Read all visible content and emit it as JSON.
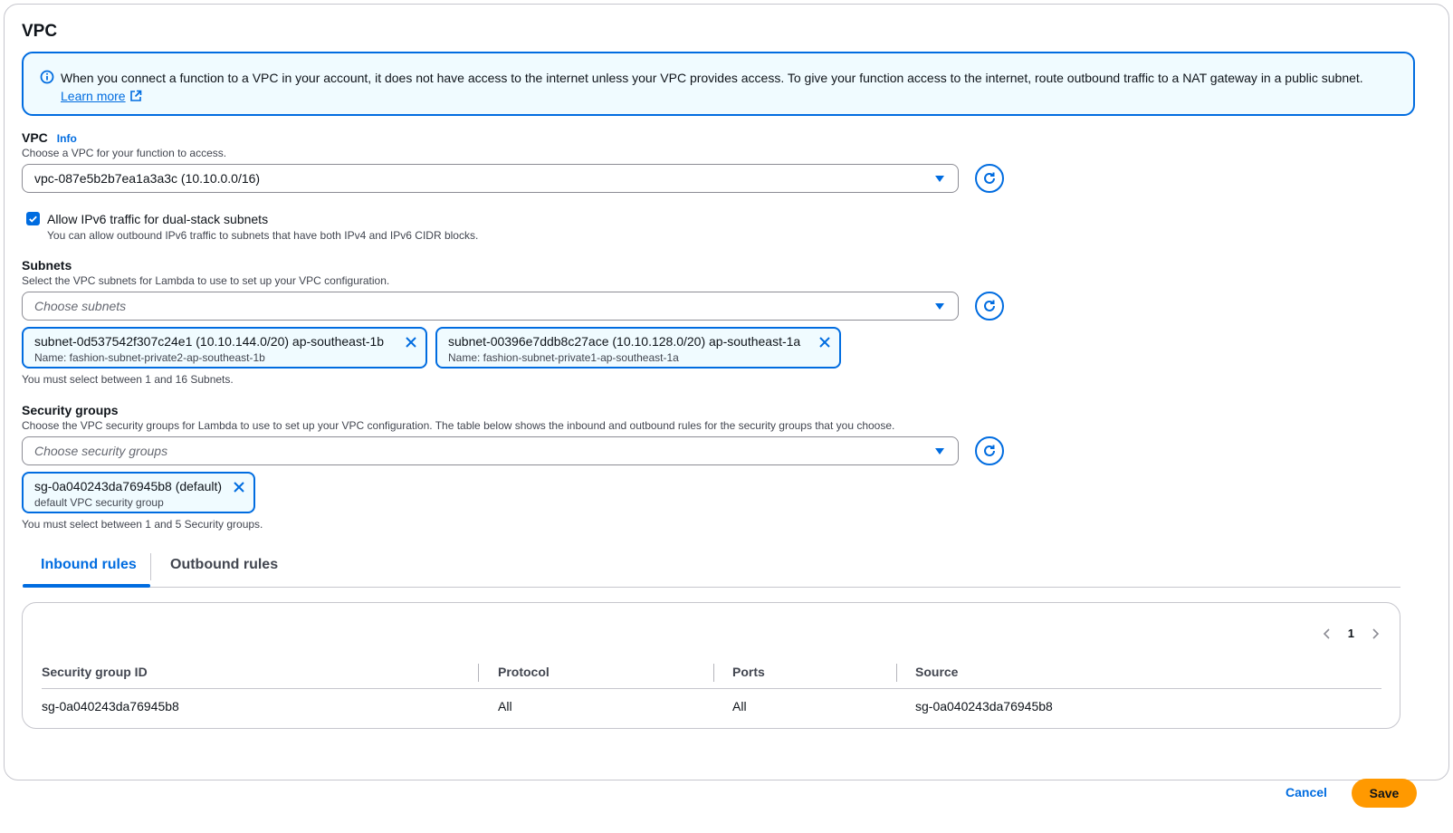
{
  "section": {
    "title": "VPC"
  },
  "alert": {
    "text": "When you connect a function to a VPC in your account, it does not have access to the internet unless your VPC provides access. To give your function access to the internet, route outbound traffic to a NAT gateway in a public subnet.",
    "link": "Learn more"
  },
  "vpc": {
    "label": "VPC",
    "info": "Info",
    "description": "Choose a VPC for your function to access.",
    "value": "vpc-087e5b2b7ea1a3a3c (10.10.0.0/16)"
  },
  "ipv6": {
    "label": "Allow IPv6 traffic for dual-stack subnets",
    "description": "You can allow outbound IPv6 traffic to subnets that have both IPv4 and IPv6 CIDR blocks.",
    "checked": true
  },
  "subnets": {
    "label": "Subnets",
    "description": "Select the VPC subnets for Lambda to use to set up your VPC configuration.",
    "placeholder": "Choose subnets",
    "tokens": [
      {
        "main": "subnet-0d537542f307c24e1 (10.10.144.0/20)   ap-southeast-1b",
        "sub": "Name: fashion-subnet-private2-ap-southeast-1b"
      },
      {
        "main": "subnet-00396e7ddb8c27ace (10.10.128.0/20)   ap-southeast-1a",
        "sub": "Name: fashion-subnet-private1-ap-southeast-1a"
      }
    ],
    "hint": "You must select between 1 and 16 Subnets."
  },
  "security_groups": {
    "label": "Security groups",
    "description": "Choose the VPC security groups for Lambda to use to set up your VPC configuration. The table below shows the inbound and outbound rules for the security groups that you choose.",
    "placeholder": "Choose security groups",
    "tokens": [
      {
        "main": "sg-0a040243da76945b8 (default)",
        "sub": "default VPC security group"
      }
    ],
    "hint": "You must select between 1 and 5 Security groups."
  },
  "tabs": {
    "inbound": "Inbound rules",
    "outbound": "Outbound rules"
  },
  "rules_table": {
    "page": "1",
    "columns": [
      "Security group ID",
      "Protocol",
      "Ports",
      "Source"
    ],
    "rows": [
      [
        "sg-0a040243da76945b8",
        "All",
        "All",
        "sg-0a040243da76945b8"
      ]
    ]
  },
  "footer": {
    "cancel": "Cancel",
    "save": "Save"
  },
  "colors": {
    "accent": "#006ce0",
    "primary_button": "#ff9900",
    "info_bg": "#f0fbff"
  },
  "icons": [
    "info-icon",
    "external-link-icon",
    "caret-down-icon",
    "refresh-icon",
    "check-icon",
    "close-icon",
    "chevron-left-icon",
    "chevron-right-icon"
  ]
}
